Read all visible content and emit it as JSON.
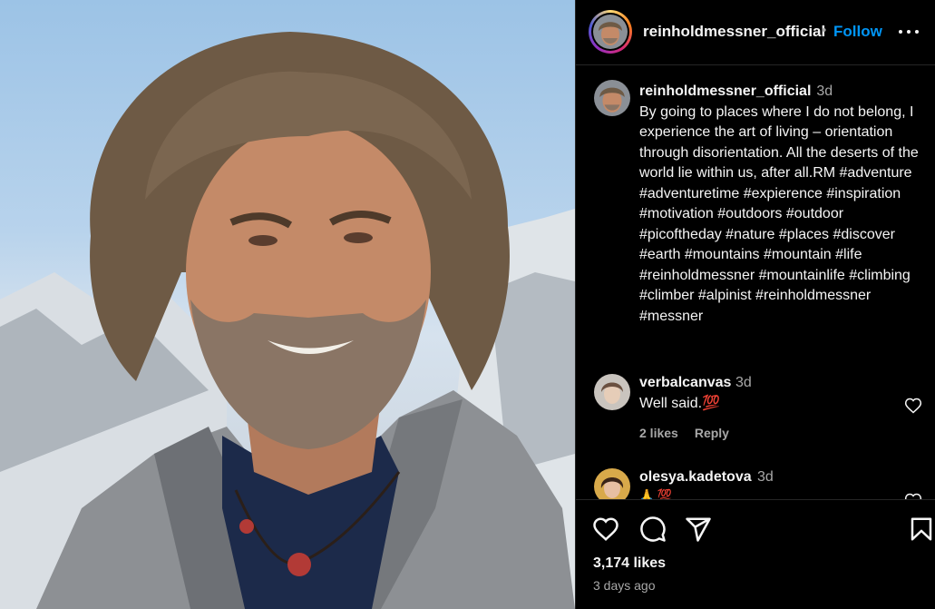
{
  "post": {
    "photo_icon": "portrait-photo",
    "username": "reinholdmessner_official",
    "follow_label": "Follow",
    "separator": "•"
  },
  "caption": {
    "username": "reinholdmessner_official",
    "time": "3d",
    "text": "By going to places where I do not belong, I experience the art of living – orientation through disorientation. All the deserts of the world lie within us, after all.RM #adventure #adventuretime #expierence #inspiration #motivation #outdoors #outdoor #picoftheday #nature #places #discover #earth #mountains #mountain #life #reinholdmessner #mountainlife #climbing #climber #alpinist #reinholdmessner #messner"
  },
  "comments": [
    {
      "username": "verbalcanvas",
      "time": "3d",
      "text": "Well said.💯",
      "likes": "2 likes",
      "reply": "Reply"
    },
    {
      "username": "olesya.kadetova",
      "time": "3d",
      "text": "🙏 💯",
      "likes": "",
      "reply": ""
    }
  ],
  "actions": {
    "likes": "3,174 likes",
    "time_ago": "3 days ago",
    "icons": [
      "heart-icon",
      "comment-icon",
      "share-icon",
      "bookmark-icon"
    ]
  },
  "colors": {
    "accent": "#0095f6",
    "muted": "#a8a8a8",
    "background": "#000000",
    "border": "#262626"
  }
}
